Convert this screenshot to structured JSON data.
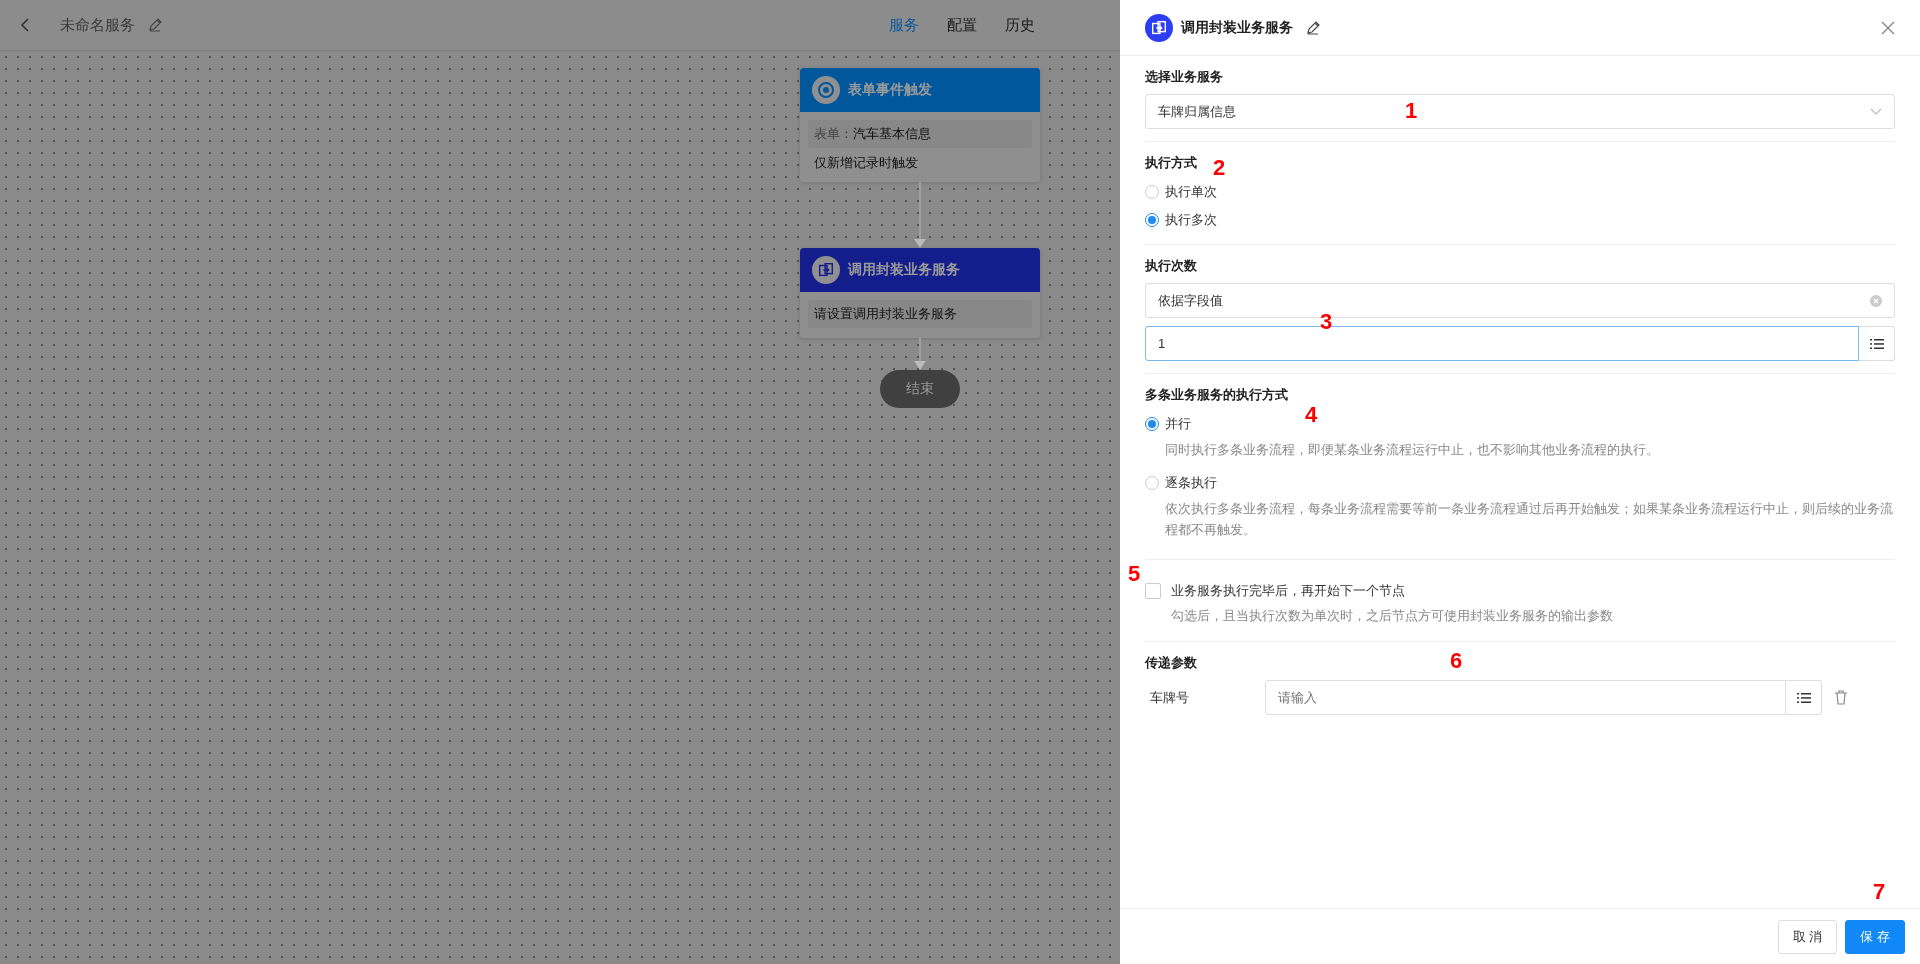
{
  "header": {
    "title": "未命名服务",
    "tabs": [
      {
        "label": "服务",
        "selected": true
      },
      {
        "label": "配置",
        "selected": false
      },
      {
        "label": "历史",
        "selected": false
      }
    ]
  },
  "flow": {
    "nodes": [
      {
        "kind": "trigger",
        "title": "表单事件触发",
        "color": "#00579b",
        "body": [
          {
            "kind": "field",
            "label": "表单：",
            "value": "汽车基本信息"
          },
          {
            "kind": "note",
            "text": "仅新增记录时触发"
          }
        ]
      },
      {
        "kind": "service",
        "title": "调用封装业务服务",
        "color": "#141d8c",
        "body": [
          {
            "kind": "hint",
            "text": "请设置调用封装业务服务"
          }
        ]
      }
    ],
    "end": {
      "label": "结束"
    }
  },
  "panel": {
    "title": "调用封装业务服务",
    "sections": [
      {
        "kind": "select",
        "label": "选择业务服务",
        "value": "车牌归属信息"
      },
      {
        "kind": "radios",
        "label": "执行方式",
        "options": [
          {
            "label": "执行单次",
            "selected": false
          },
          {
            "label": "执行多次",
            "selected": true
          }
        ]
      },
      {
        "kind": "count",
        "label": "执行次数",
        "source": "依据字段值",
        "value": "1"
      },
      {
        "kind": "radios",
        "label": "多条业务服务的执行方式",
        "options": [
          {
            "label": "并行",
            "selected": true,
            "description": "同时执行多条业务流程，即便某条业务流程运行中止，也不影响其他业务流程的执行。"
          },
          {
            "label": "逐条执行",
            "selected": false,
            "description": "依次执行多条业务流程，每条业务流程需要等前一条业务流程通过后再开始触发；如果某条业务流程运行中止，则后续的业务流程都不再触发。"
          }
        ]
      },
      {
        "kind": "checkbox",
        "label": "业务服务执行完毕后，再开始下一个节点",
        "checked": false,
        "description": "勾选后，且当执行次数为单次时，之后节点方可使用封装业务服务的输出参数"
      },
      {
        "kind": "params",
        "label": "传递参数",
        "params": [
          {
            "name": "车牌号",
            "placeholder": "请输入"
          }
        ]
      }
    ],
    "buttons": [
      {
        "kind": "default",
        "label": "取 消"
      },
      {
        "kind": "primary",
        "label": "保 存"
      }
    ]
  },
  "annotation_marks": [
    "1",
    "2",
    "3",
    "4",
    "5",
    "6",
    "7"
  ]
}
